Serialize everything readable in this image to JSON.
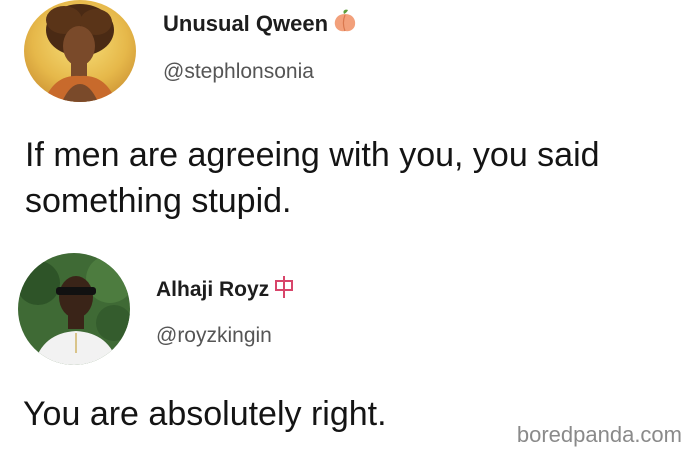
{
  "tweets": [
    {
      "display_name": "Unusual Qween",
      "name_emoji": "peach-icon",
      "handle": "@stephlonsonia",
      "text": "If men are agreeing with you, you said something stupid."
    },
    {
      "display_name": "Alhaji Royz",
      "name_emoji": "sigil-icon",
      "handle": "@royzkingin",
      "text": "You are absolutely right."
    }
  ],
  "watermark": "boredpanda.com",
  "colors": {
    "peach": "#f2a07b",
    "sigil": "#d8456a"
  }
}
